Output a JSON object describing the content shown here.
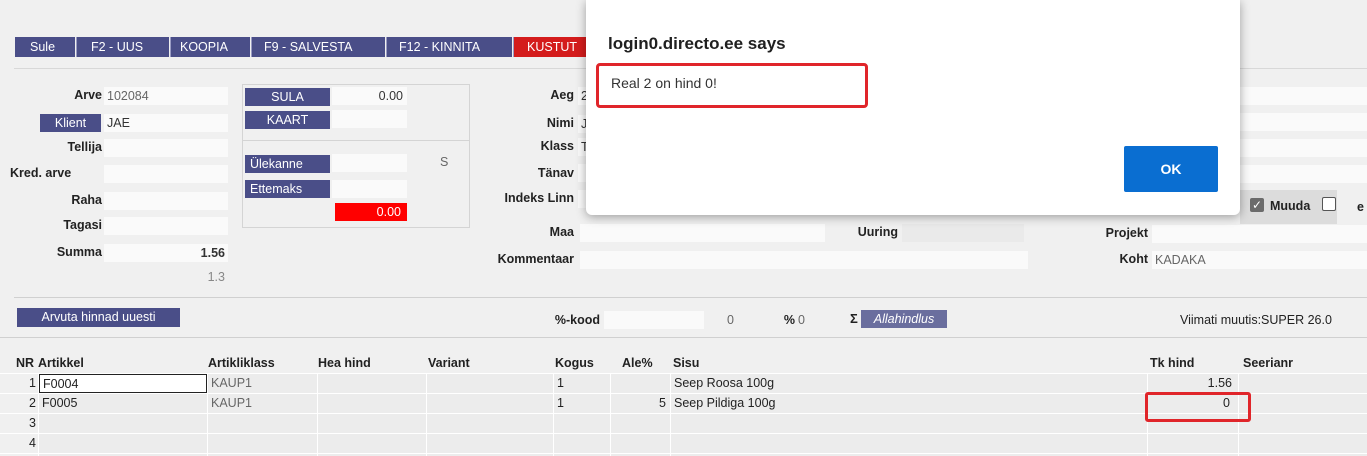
{
  "toolbar": {
    "sule": "Sule",
    "new": "F2 - UUS",
    "copy": "KOOPIA",
    "save": "F9 - SALVESTA",
    "confirm": "F12 - KINNITA",
    "delete": "KUSTUT"
  },
  "header": {
    "arve_label": "Arve",
    "arve_value": "102084",
    "klient_button": "Klient",
    "klient_value": "JAE",
    "tellija_label": "Tellija",
    "kred_label": "Kred. arve",
    "raha_label": "Raha",
    "tagasi_label": "Tagasi",
    "summa_label": "Summa",
    "summa_value": "1.56",
    "sub_value": "1.3"
  },
  "payment": {
    "sula_button": "SULA",
    "sula_value": "0.00",
    "kaart_button": "KAART",
    "ulekanne_button": "Ülekanne",
    "ulekanne_code": "S",
    "ettemaks_button": "Ettemaks",
    "balance_value": "0.00"
  },
  "middle": {
    "aeg_label": "Aeg",
    "aeg_value": "2",
    "nimi_label": "Nimi",
    "nimi_value": "J",
    "klass_label": "Klass",
    "klass_value": "T",
    "tanav_label": "Tänav",
    "indeks_label": "Indeks Linn",
    "maa_label": "Maa",
    "uuring_label": "Uuring",
    "kommentaar_label": "Kommentaar",
    "projekt_label": "Projekt",
    "koht_label": "Koht",
    "koht_value": "KADAKA",
    "muuda_label": "Muuda",
    "e_label": "e"
  },
  "rowbar": {
    "recalc_button": "Arvuta hinnad uuesti",
    "kood_label": "%-kood",
    "kood_value": "0",
    "pct_label": "%",
    "pct_value": "0",
    "sigma": "Σ",
    "discount_button": "Allahindlus",
    "modified": "Viimati muutis:SUPER 26.0"
  },
  "table": {
    "headers": {
      "nr": "NR",
      "artikkel": "Artikkel",
      "artikliklass": "Artikliklass",
      "hea_hind": "Hea hind",
      "variant": "Variant",
      "kogus": "Kogus",
      "ale": "Ale%",
      "sisu": "Sisu",
      "tk_hind": "Tk hind",
      "seerianr": "Seerianr"
    },
    "rows": [
      {
        "nr": "1",
        "artikkel": "F0004",
        "klass": "KAUP1",
        "kogus": "1",
        "ale": "",
        "sisu": "Seep Roosa 100g",
        "tk_hind": "1.56"
      },
      {
        "nr": "2",
        "artikkel": "F0005",
        "klass": "KAUP1",
        "kogus": "1",
        "ale": "5",
        "sisu": "Seep Pildiga 100g",
        "tk_hind": "0"
      },
      {
        "nr": "3",
        "artikkel": "",
        "klass": "",
        "kogus": "",
        "ale": "",
        "sisu": "",
        "tk_hind": ""
      },
      {
        "nr": "4",
        "artikkel": "",
        "klass": "",
        "kogus": "",
        "ale": "",
        "sisu": "",
        "tk_hind": ""
      }
    ]
  },
  "dialog": {
    "title": "login0.directo.ee says",
    "message": "Real 2 on hind 0!",
    "ok": "OK"
  },
  "colors": {
    "toolbar_button": "#4a4e88",
    "delete_button": "#d41c1c",
    "dialog_ok": "#0a6ed1",
    "highlight": "#e0252a"
  }
}
